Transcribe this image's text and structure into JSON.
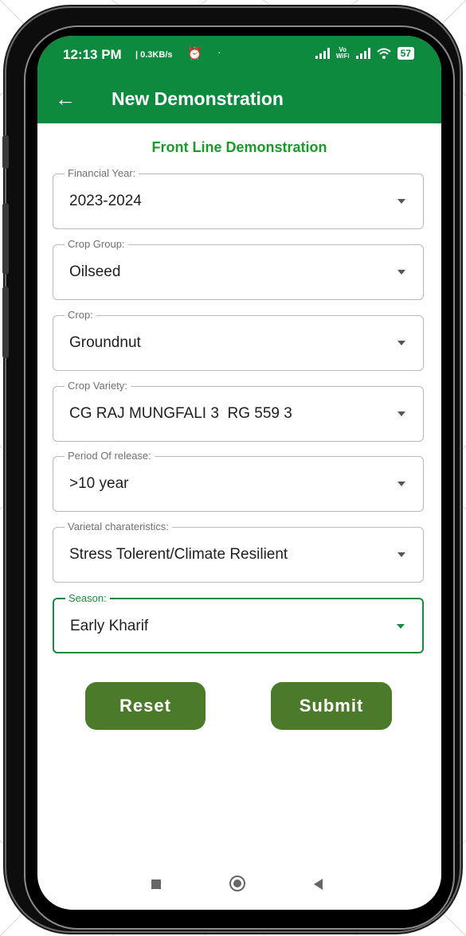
{
  "status_bar": {
    "time": "12:13 PM",
    "speed": "| 0.3KB/s",
    "dot": "·",
    "volte": "Vo\nWiFi",
    "battery": "57"
  },
  "app_bar": {
    "title": "New Demonstration"
  },
  "form": {
    "section_title": "Front Line Demonstration",
    "fields": [
      {
        "label": "Financial Year:",
        "value": "2023-2024"
      },
      {
        "label": "Crop Group:",
        "value": "Oilseed"
      },
      {
        "label": "Crop:",
        "value": "Groundnut"
      },
      {
        "label": "Crop Variety:",
        "value": "CG RAJ MUNGFALI 3  RG 559 3"
      },
      {
        "label": "Period Of release:",
        "value": ">10 year"
      },
      {
        "label": "Varietal charateristics:",
        "value": "Stress Tolerent/Climate Resilient"
      },
      {
        "label": "Season:",
        "value": "Early Kharif"
      }
    ]
  },
  "actions": {
    "reset_label": "Reset",
    "submit_label": "Submit"
  },
  "colors": {
    "brand_green": "#0e8a3e",
    "button_green": "#4c7a2b",
    "title_green": "#1b9a2a"
  }
}
